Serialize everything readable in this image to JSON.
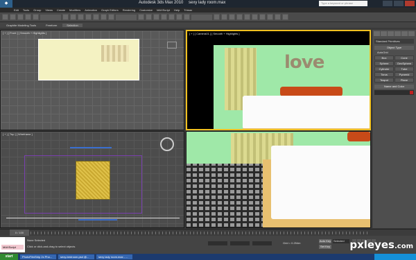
{
  "app": {
    "title": "Autodesk 3ds Max 2010",
    "file": "sexy lady room.max",
    "search_placeholder": "Type a keyword or phrase"
  },
  "menu": [
    "Edit",
    "Tools",
    "Group",
    "Views",
    "Create",
    "Modifiers",
    "Animation",
    "Graph Editors",
    "Rendering",
    "Customize",
    "MAXScript",
    "Help",
    "Trimax"
  ],
  "ribbon": {
    "tabs": [
      "Graphite Modeling Tools",
      "Freeform",
      "Selection"
    ],
    "active": "Selection"
  },
  "viewports": {
    "front": "[ + ] [ Front ] [ Smooth + Highlights ]",
    "camera": "[ + ] [ Camera01 ] [ Smooth + Highlights ]",
    "top": "[ + ] [ Top ] [ Wireframe ]",
    "perspective": ""
  },
  "scene": {
    "wall_text": "love"
  },
  "command_panel": {
    "category": "Standard Primitives",
    "object_type_title": "Object Type",
    "autogrid": "AutoGrid",
    "buttons": [
      "Box",
      "Cone",
      "Sphere",
      "GeoSphere",
      "Cylinder",
      "Tube",
      "Torus",
      "Pyramid",
      "Teapot",
      "Plane"
    ],
    "name_color_title": "Name and Color"
  },
  "timeline": {
    "frame": "0 / 100"
  },
  "status": {
    "maxscript_field": "MAXScript",
    "selected": "None Selected",
    "prompt": "Click or click-and-drag to select objects",
    "grid": "Grid = 0.254m",
    "auto_key": "Auto Key",
    "set_key": "Set Key",
    "key_filter": "Selected"
  },
  "taskbar": {
    "start": "start",
    "tasks": [
      "PhotoFilmStrip 2x Pho...",
      "sexy-bedroom.psd @...",
      "sexy lady room.max - ..."
    ]
  },
  "watermark": {
    "brand": "pxleyes",
    "suffix": ".com"
  },
  "colors": {
    "wall": "#9fe8a8",
    "pillow": "#c84a18",
    "rug": "#e0c24a",
    "active_viewport_border": "#f0c020"
  }
}
